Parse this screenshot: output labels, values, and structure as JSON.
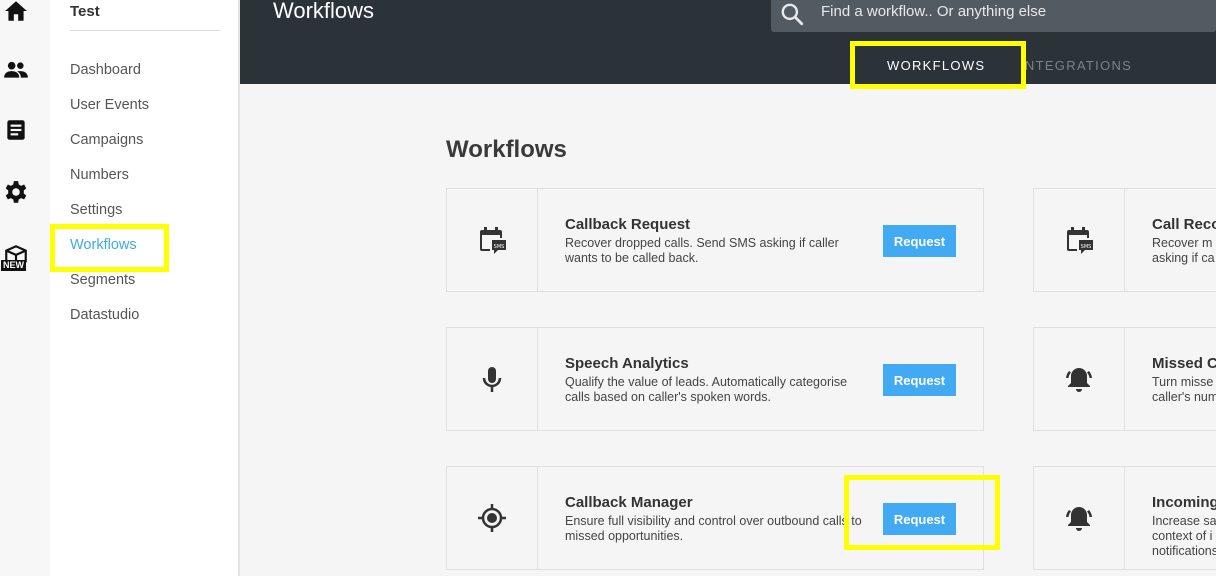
{
  "rail": {
    "icons": [
      "home-icon",
      "people-icon",
      "document-icon",
      "gear-icon",
      "box-icon"
    ],
    "new_badge": "NEW"
  },
  "sidebar": {
    "project_name": "Test",
    "items": [
      {
        "label": "Dashboard"
      },
      {
        "label": "User Events"
      },
      {
        "label": "Campaigns"
      },
      {
        "label": "Numbers"
      },
      {
        "label": "Settings"
      },
      {
        "label": "Workflows",
        "active": true
      },
      {
        "label": "Segments"
      },
      {
        "label": "Datastudio"
      }
    ]
  },
  "header": {
    "title": "Workflows",
    "search_placeholder": "Find a workflow.. Or anything else",
    "tabs": [
      {
        "label": "WORKFLOWS",
        "active": true
      },
      {
        "label": "INTEGRATIONS",
        "active": false
      }
    ]
  },
  "main": {
    "title": "Workflows",
    "cards": [
      {
        "icon": "calendar-sms-icon",
        "title": "Callback Request",
        "desc": "Recover dropped calls. Send SMS asking if caller wants to be called back.",
        "button": "Request"
      },
      {
        "icon": "calendar-sms-icon",
        "title": "Call Reco",
        "desc": "Recover m asking if ca"
      },
      {
        "icon": "microphone-icon",
        "title": "Speech Analytics",
        "desc": "Qualify the value of leads. Automatically categorise calls based on caller's spoken words.",
        "button": "Request"
      },
      {
        "icon": "bell-icon",
        "title": "Missed C",
        "desc": "Turn misse caller's num"
      },
      {
        "icon": "target-icon",
        "title": "Callback Manager",
        "desc": "Ensure full visibility and control over outbound calls to missed opportunities.",
        "button": "Request"
      },
      {
        "icon": "bell-icon",
        "title": "Incoming",
        "desc": "Increase sa context of i notifications"
      }
    ]
  },
  "colors": {
    "accent": "#41aaf2",
    "active_nav": "#41a9e8",
    "header_bg": "#2b3238",
    "highlight": "#ffff00"
  }
}
